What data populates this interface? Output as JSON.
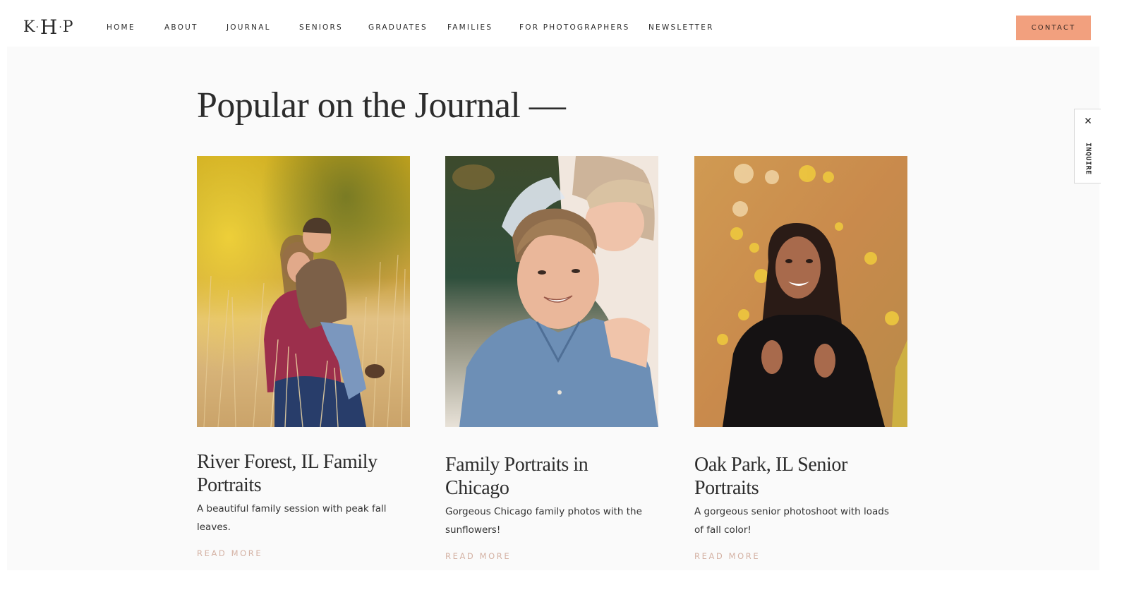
{
  "header": {
    "logo": {
      "left": "K",
      "middle": "H",
      "right": "P",
      "separator": "·"
    },
    "nav": [
      {
        "label": "HOME"
      },
      {
        "label": "ABOUT"
      },
      {
        "label": "JOURNAL"
      },
      {
        "label": "SENIORS"
      },
      {
        "label": "GRADUATES"
      },
      {
        "label": "FAMILIES"
      },
      {
        "label": "FOR PHOTOGRAPHERS"
      },
      {
        "label": "NEWSLETTER"
      }
    ],
    "contact_label": "CONTACT"
  },
  "colors": {
    "accent": "#f2a07e",
    "read_more": "#d4b2a4",
    "panel_bg": "#fafafa",
    "text": "#2c2c2c"
  },
  "section": {
    "title": "Popular on the Journal —"
  },
  "posts": [
    {
      "title": "River Forest, IL Family Portraits",
      "description": "A beautiful family session with peak fall leaves.",
      "read_more": "READ MORE",
      "image_alt": "Mother hugging son in golden autumn grass"
    },
    {
      "title": "Family Portraits in Chicago",
      "description": "Gorgeous Chicago family photos with the sunflowers!",
      "read_more": "READ MORE",
      "image_alt": "Smiling boy in blue shirt embraced by mother"
    },
    {
      "title": "Oak Park, IL Senior Portraits",
      "description": "A gorgeous senior photoshoot with loads of fall color!",
      "read_more": "READ MORE",
      "image_alt": "Smiling senior girl in black sweater with fall foliage"
    }
  ],
  "inquire": {
    "label": "INQUIRE",
    "close_icon": "close-icon"
  }
}
